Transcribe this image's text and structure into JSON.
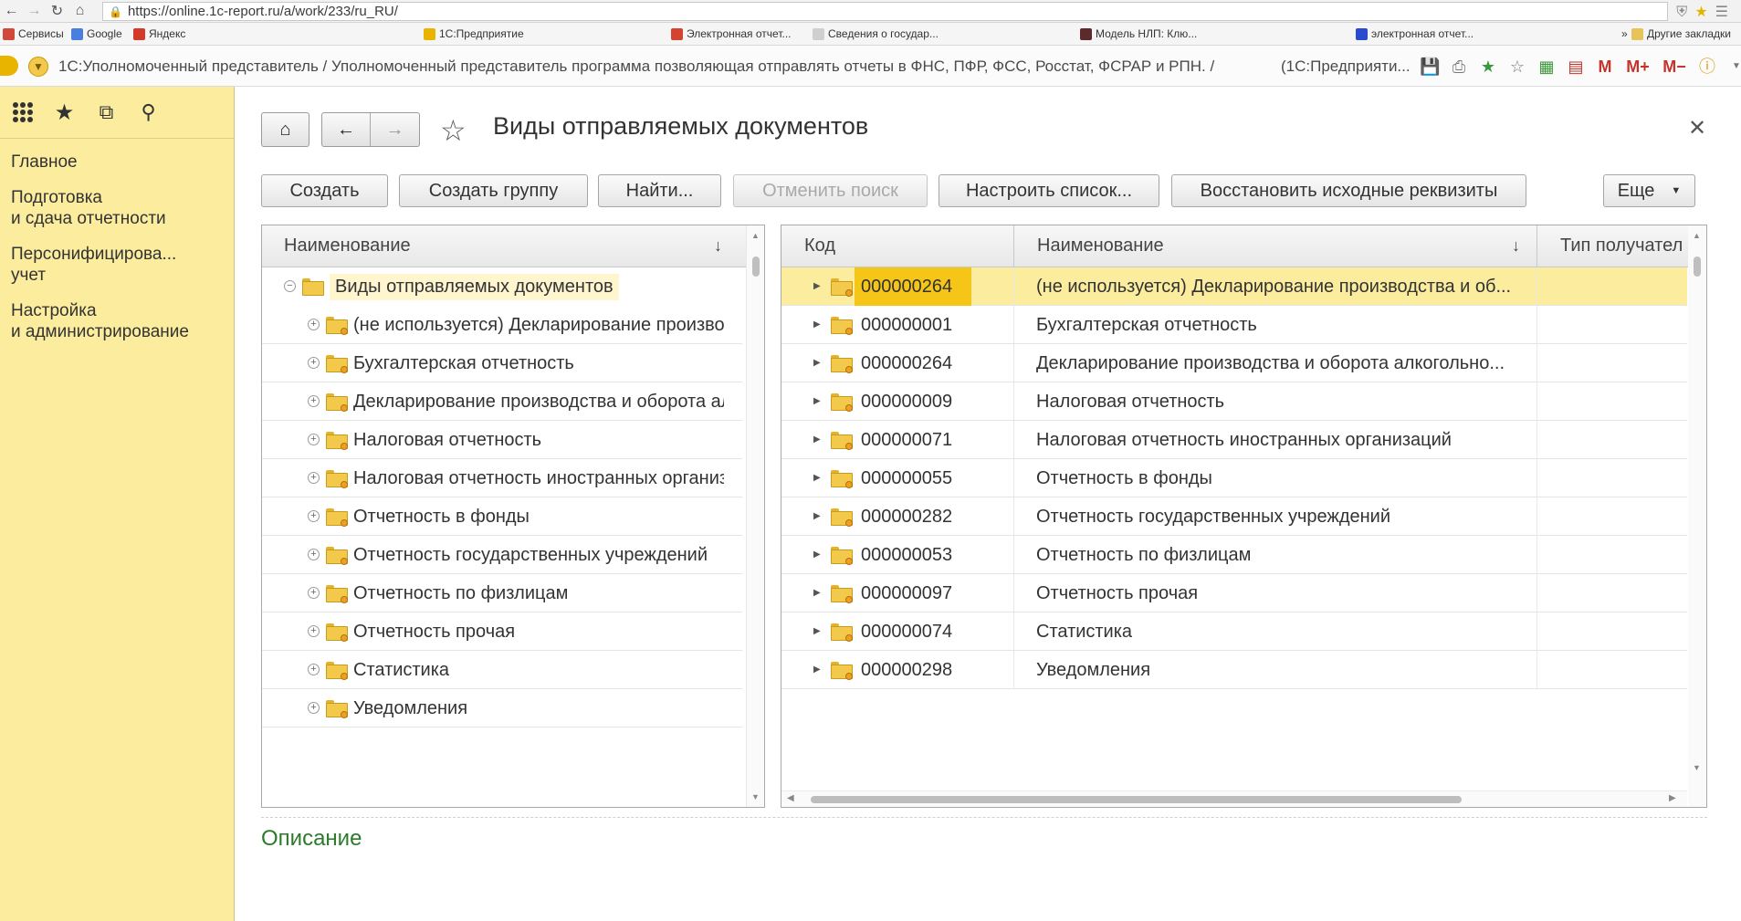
{
  "browser": {
    "url": "https://online.1c-report.ru/a/work/233/ru_RU/",
    "bookmarks": [
      {
        "label": "Сервисы",
        "color": "#d04a3a"
      },
      {
        "label": "Google",
        "color": "#4a7fe0"
      },
      {
        "label": "Яндекс",
        "color": "#d23a2a"
      },
      {
        "label": "1С:Предприятие",
        "color": "#e8b400"
      },
      {
        "label": "Электронная отчет...",
        "color": "#d2442f"
      },
      {
        "label": "Сведения о государ...",
        "color": "#cfcfcf"
      },
      {
        "label": "Модель НЛП: Клю...",
        "color": "#5c2a2a"
      },
      {
        "label": "электронная отчет...",
        "color": "#2a4bd0"
      },
      {
        "label": "Другие закладки",
        "color": "#e8c35a"
      }
    ],
    "bookmarks_more": "»"
  },
  "app": {
    "title": "1С:Уполномоченный представитель / Уполномоченный представитель программа позволяющая отправлять отчеты в ФНС, ПФР, ФСС, Росстат, ФСРАР и РПН. /",
    "title_suffix": "(1С:Предприяти...",
    "tool_m": "M",
    "tool_mplus": "M+",
    "tool_mminus": "M−"
  },
  "sidebar": {
    "items": [
      {
        "line1": "Главное",
        "line2": ""
      },
      {
        "line1": "Подготовка",
        "line2": "и сдача отчетности"
      },
      {
        "line1": "Персонифицирова...",
        "line2": "учет"
      },
      {
        "line1": "Настройка",
        "line2": "и администрирование"
      }
    ]
  },
  "form": {
    "title": "Виды отправляемых документов",
    "commands": {
      "create": "Создать",
      "create_group": "Создать группу",
      "find": "Найти...",
      "cancel_search": "Отменить поиск",
      "configure_list": "Настроить список...",
      "restore": "Восстановить исходные реквизиты",
      "more": "Еще"
    },
    "description_label": "Описание"
  },
  "tree": {
    "column": "Наименование",
    "root": "Виды отправляемых документов",
    "items": [
      "(не используется) Декларирование производства и оборота алкогольной продукции",
      "Бухгалтерская отчетность",
      "Декларирование производства и оборота алкогольной продукции",
      "Налоговая отчетность",
      "Налоговая отчетность иностранных организаций",
      "Отчетность в фонды",
      "Отчетность государственных учреждений",
      "Отчетность по физлицам",
      "Отчетность прочая",
      "Статистика",
      "Уведомления"
    ]
  },
  "grid": {
    "columns": {
      "code": "Код",
      "name": "Наименование",
      "type": "Тип получател"
    },
    "selected_index": 0,
    "rows": [
      {
        "code": "000000264",
        "name": "(не используется) Декларирование производства и об..."
      },
      {
        "code": "000000001",
        "name": "Бухгалтерская отчетность"
      },
      {
        "code": "000000264",
        "name": "Декларирование производства и оборота алкогольно..."
      },
      {
        "code": "000000009",
        "name": "Налоговая отчетность"
      },
      {
        "code": "000000071",
        "name": "Налоговая отчетность иностранных организаций"
      },
      {
        "code": "000000055",
        "name": "Отчетность в фонды"
      },
      {
        "code": "000000282",
        "name": "Отчетность государственных учреждений"
      },
      {
        "code": "000000053",
        "name": "Отчетность по физлицам"
      },
      {
        "code": "000000097",
        "name": "Отчетность прочая"
      },
      {
        "code": "000000074",
        "name": "Статистика"
      },
      {
        "code": "000000298",
        "name": "Уведомления"
      }
    ]
  }
}
